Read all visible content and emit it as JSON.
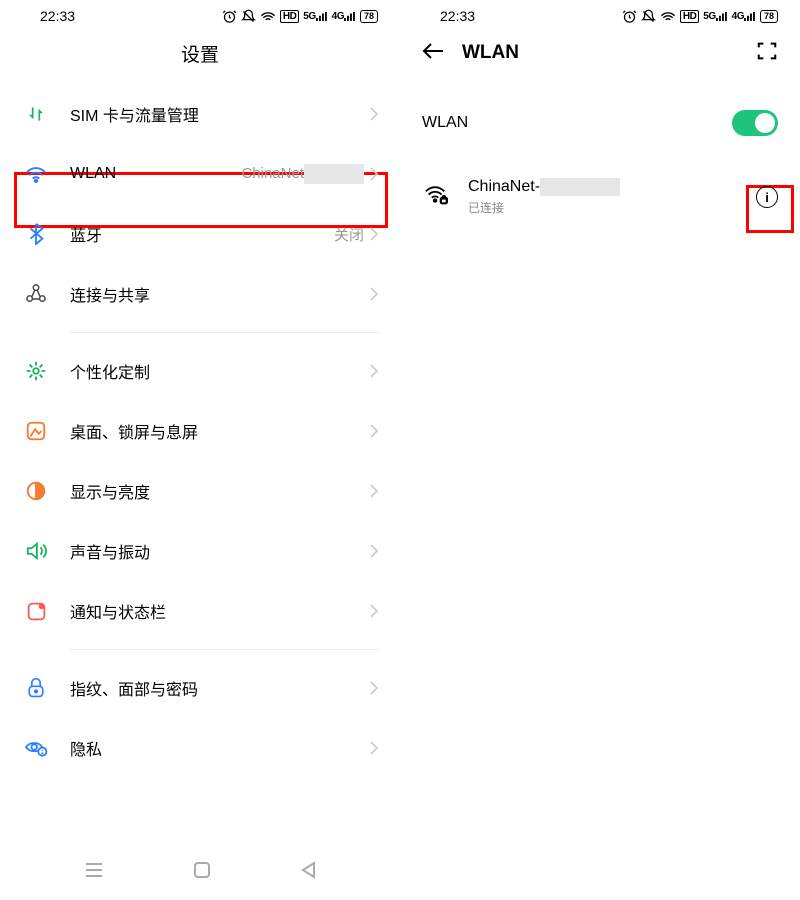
{
  "colors": {
    "accent": "#1fc47c"
  },
  "statusbar": {
    "time": "22:33",
    "battery": "78"
  },
  "left": {
    "title": "设置",
    "items": [
      {
        "label": "SIM 卡与流量管理",
        "value": ""
      },
      {
        "label": "WLAN",
        "value": "ChinaNet"
      },
      {
        "label": "蓝牙",
        "value": "关闭"
      },
      {
        "label": "连接与共享",
        "value": ""
      },
      {
        "label": "个性化定制",
        "value": ""
      },
      {
        "label": "桌面、锁屏与息屏",
        "value": ""
      },
      {
        "label": "显示与亮度",
        "value": ""
      },
      {
        "label": "声音与振动",
        "value": ""
      },
      {
        "label": "通知与状态栏",
        "value": ""
      },
      {
        "label": "指纹、面部与密码",
        "value": ""
      },
      {
        "label": "隐私",
        "value": ""
      }
    ]
  },
  "right": {
    "title": "WLAN",
    "toggle_label": "WLAN",
    "toggle_on": true,
    "network": {
      "name_prefix": "ChinaNet-",
      "status": "已连接"
    }
  }
}
